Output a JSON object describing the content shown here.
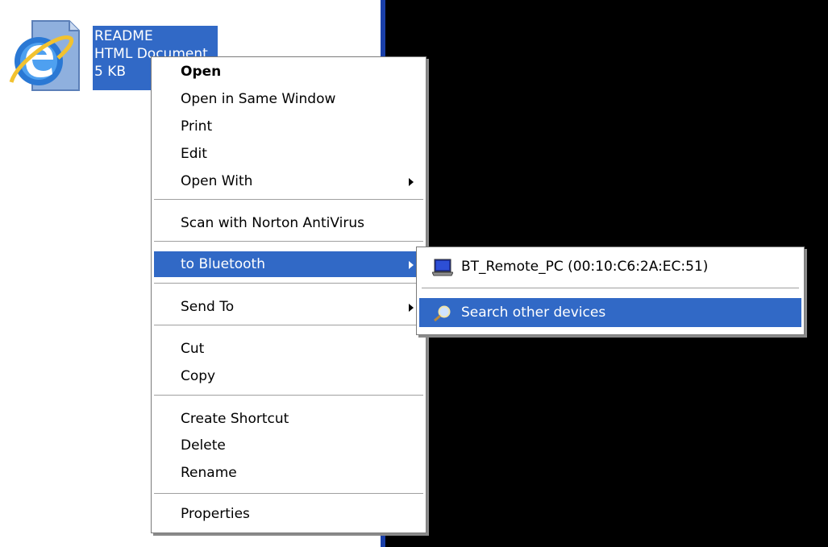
{
  "file": {
    "name": "README",
    "type": "HTML Document",
    "size": "5 KB",
    "icon": "ie-html-document-icon"
  },
  "context_menu": {
    "items": [
      {
        "label": "Open",
        "bold": true
      },
      {
        "label": "Open in Same Window"
      },
      {
        "label": "Print"
      },
      {
        "label": "Edit"
      },
      {
        "label": "Open With",
        "has_submenu": true
      },
      {
        "label": "Scan with Norton AntiVirus"
      },
      {
        "label": "to Bluetooth",
        "has_submenu": true,
        "selected": true
      },
      {
        "label": "Send To",
        "has_submenu": true
      },
      {
        "label": "Cut"
      },
      {
        "label": "Copy"
      },
      {
        "label": "Create Shortcut"
      },
      {
        "label": "Delete"
      },
      {
        "label": "Rename"
      },
      {
        "label": "Properties"
      }
    ]
  },
  "bluetooth_submenu": {
    "items": [
      {
        "label": "BT_Remote_PC (00:10:C6:2A:EC:51)",
        "icon": "laptop-icon"
      },
      {
        "label": "Search other devices",
        "icon": "search-icon",
        "selected": true
      }
    ]
  },
  "colors": {
    "selection": "#3169c6",
    "desktop": "#000000"
  }
}
